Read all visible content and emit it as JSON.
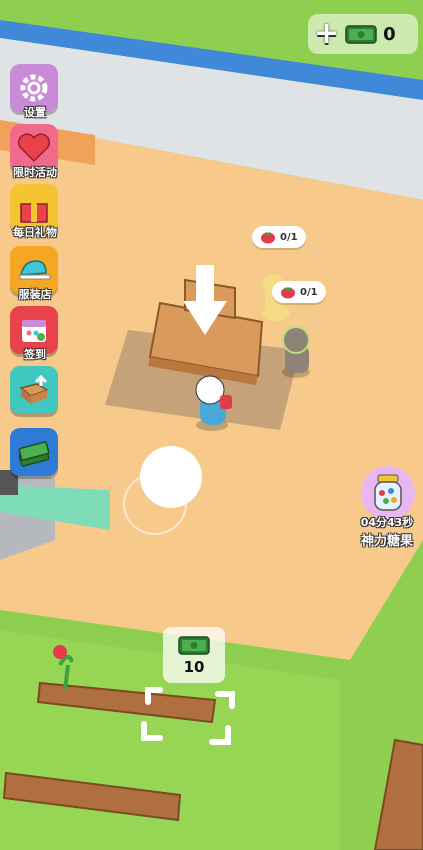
{
  "hud": {
    "money": {
      "amount": "0",
      "add_icon": "plus-icon",
      "currency_icon": "cash-icon"
    }
  },
  "sidebar": {
    "items": [
      {
        "label": "设置",
        "icon": "gear-icon",
        "color": "#c98bd8"
      },
      {
        "label": "限时活动",
        "icon": "heart-icon",
        "color": "#f06a8a"
      },
      {
        "label": "每日礼物",
        "icon": "gift-icon",
        "color": "#f5c531"
      },
      {
        "label": "服装店",
        "icon": "cap-icon",
        "color": "#f5a623"
      },
      {
        "label": "签到",
        "icon": "calendar-icon",
        "color": "#e8434b"
      },
      {
        "label": "",
        "icon": "box-upgrade-icon",
        "color": "#3fc7c0"
      },
      {
        "label": "",
        "icon": "cash-stack-icon",
        "color": "#2d7bd6"
      }
    ]
  },
  "orders": [
    {
      "text": "0/1",
      "icon": "tomato-icon"
    },
    {
      "text": "0/1",
      "icon": "tomato-icon"
    }
  ],
  "powerup": {
    "timer": "04分43秒",
    "name": "神力糖果",
    "icon": "candy-jar-icon"
  },
  "build_spot": {
    "cost": "10",
    "icon": "cash-icon"
  },
  "colors": {
    "ground": "#f7c98a",
    "grass": "#8fcf4f",
    "road": "#d9dde0",
    "counter": "#d99a5b"
  }
}
